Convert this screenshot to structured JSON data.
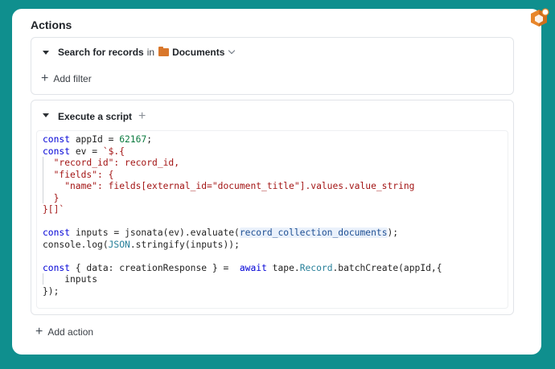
{
  "page": {
    "title": "Actions"
  },
  "search_section": {
    "label_bold": "Search for records",
    "label_in": "in",
    "folder_name": "Documents",
    "add_filter": "Add filter"
  },
  "script_section": {
    "label": "Execute a script",
    "code_lines": [
      "const appId = 62167;",
      "const ev = `$.{",
      "  \"record_id\": record_id,",
      "  \"fields\": {",
      "    \"name\": fields[external_id=\"document_title\"].values.value_string",
      "  }",
      "}[]`",
      "",
      "const inputs = jsonata(ev).evaluate(record_collection_documents);",
      "console.log(JSON.stringify(inputs));",
      "",
      "const { data: creationResponse } =  await tape.Record.batchCreate(appId,{",
      "    inputs",
      "});"
    ]
  },
  "footer": {
    "add_action": "Add action"
  },
  "colors": {
    "background": "#0f8f8e",
    "folder": "#d9772b",
    "badge": "#e8862a"
  }
}
